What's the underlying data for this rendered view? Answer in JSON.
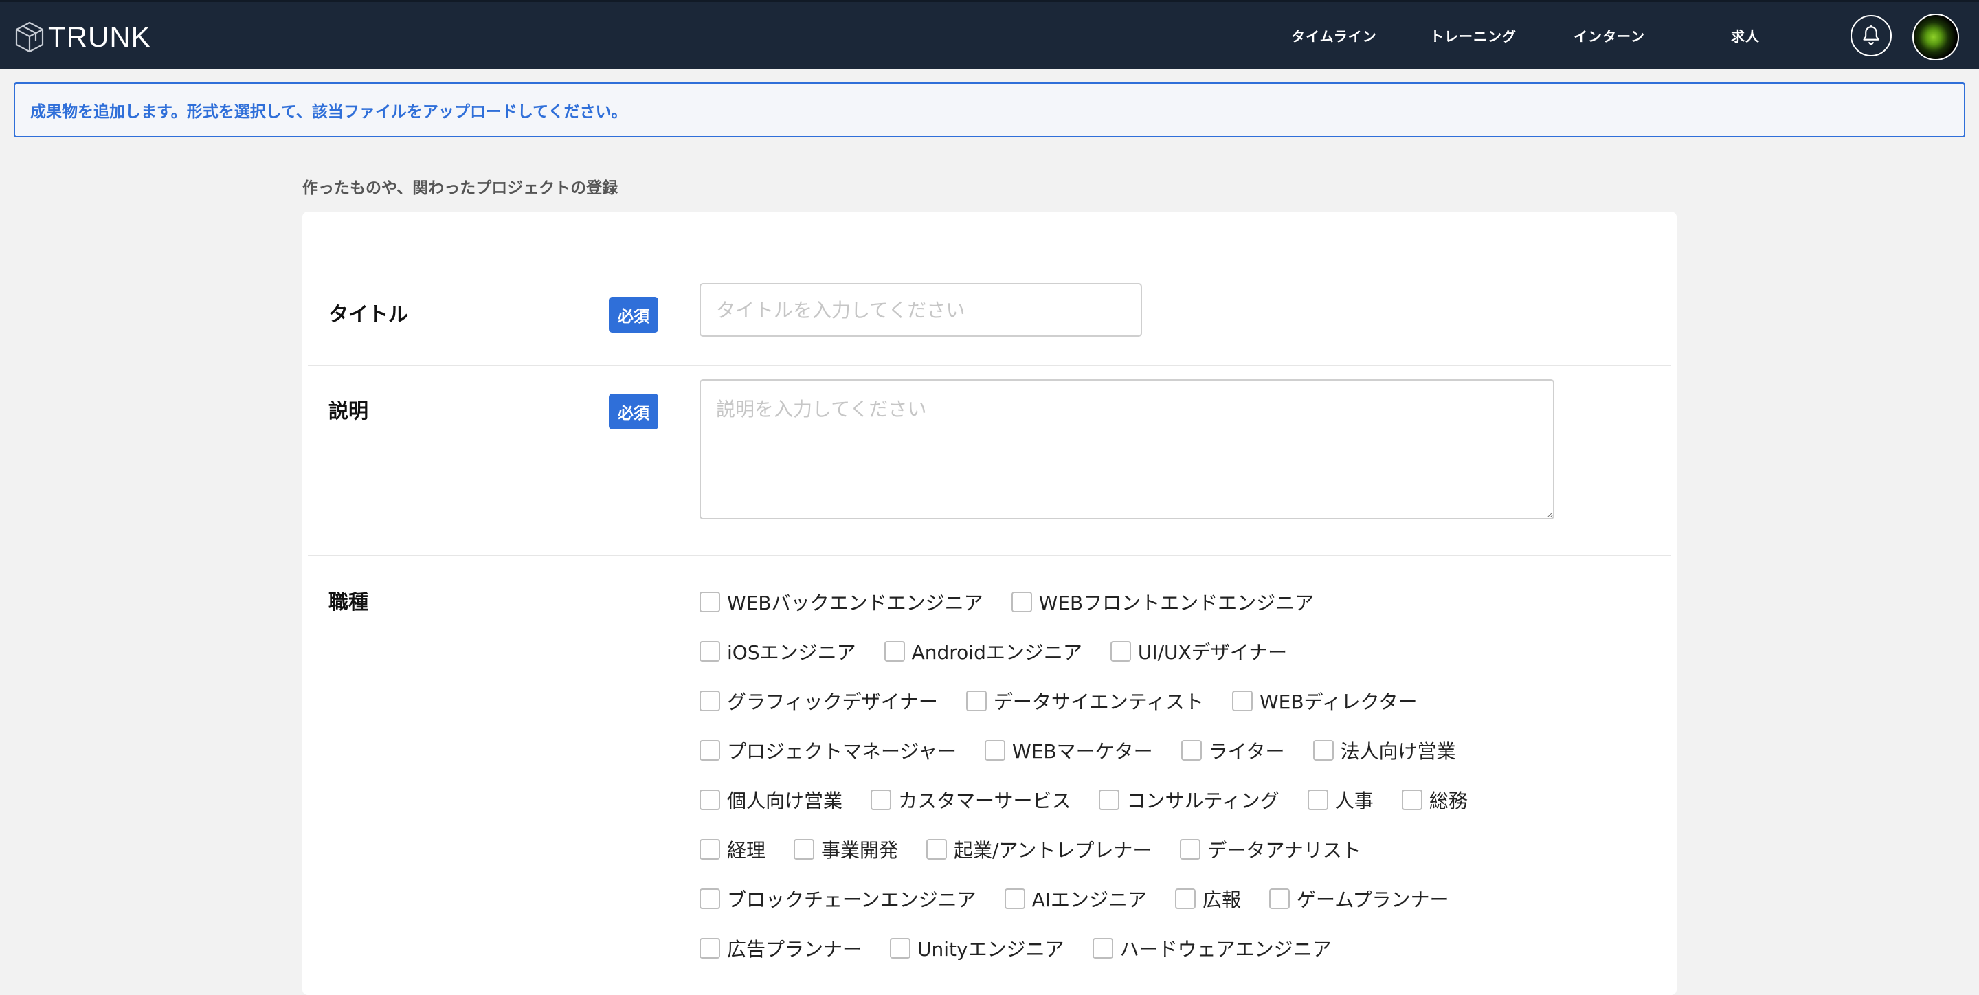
{
  "header": {
    "logo_text": "TRUNK",
    "nav": [
      {
        "label": "タイムライン"
      },
      {
        "label": "トレーニング"
      },
      {
        "label": "インターン"
      },
      {
        "label": "求人"
      }
    ],
    "icons": {
      "notification": "bell-icon",
      "user": "avatar"
    }
  },
  "alert": {
    "message": "成果物を追加します。形式を選択して、該当ファイルをアップロードしてください。"
  },
  "page": {
    "section_heading": "作ったものや、関わったプロジェクトの登録"
  },
  "form": {
    "title": {
      "label": "タイトル",
      "badge": "必須",
      "placeholder": "タイトルを入力してください",
      "value": ""
    },
    "description": {
      "label": "説明",
      "badge": "必須",
      "placeholder": "説明を入力してください",
      "value": ""
    },
    "job_types": {
      "label": "職種",
      "rows": [
        [
          {
            "label": "WEBバックエンドエンジニア"
          },
          {
            "label": "WEBフロントエンドエンジニア"
          }
        ],
        [
          {
            "label": "iOSエンジニア"
          },
          {
            "label": "Androidエンジニア"
          },
          {
            "label": "UI/UXデザイナー"
          }
        ],
        [
          {
            "label": "グラフィックデザイナー"
          },
          {
            "label": "データサイエンティスト"
          },
          {
            "label": "WEBディレクター"
          }
        ],
        [
          {
            "label": "プロジェクトマネージャー"
          },
          {
            "label": "WEBマーケター"
          },
          {
            "label": "ライター"
          },
          {
            "label": "法人向け営業"
          }
        ],
        [
          {
            "label": "個人向け営業"
          },
          {
            "label": "カスタマーサービス"
          },
          {
            "label": "コンサルティング"
          },
          {
            "label": "人事"
          },
          {
            "label": "総務"
          }
        ],
        [
          {
            "label": "経理"
          },
          {
            "label": "事業開発"
          },
          {
            "label": "起業/アントレプレナー"
          },
          {
            "label": "データアナリスト"
          }
        ],
        [
          {
            "label": "ブロックチェーンエンジニア"
          },
          {
            "label": "AIエンジニア"
          },
          {
            "label": "広報"
          },
          {
            "label": "ゲームプランナー"
          }
        ],
        [
          {
            "label": "広告プランナー"
          },
          {
            "label": "Unityエンジニア"
          },
          {
            "label": "ハードウェアエンジニア"
          }
        ]
      ]
    }
  },
  "colors": {
    "navbar": "#1b2738",
    "accent": "#2f6fd9",
    "page_bg": "#f2f2f2"
  }
}
